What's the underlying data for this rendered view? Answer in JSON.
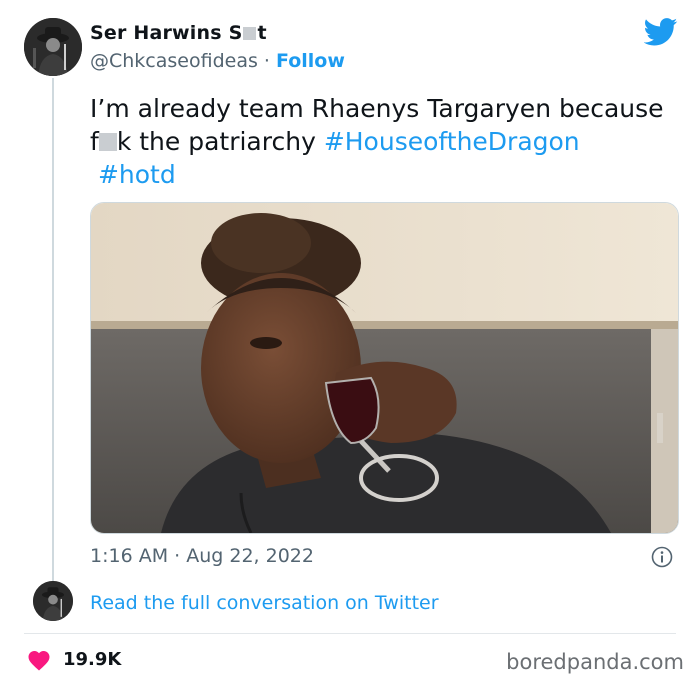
{
  "author": {
    "name_part1": "Ser Harwins S",
    "name_part2": "t",
    "handle": "@Chkcaseofideas",
    "separator": " · ",
    "follow_label": "Follow"
  },
  "tweet": {
    "text_line1": "I’m already team Rhaenys Targaryen because",
    "text_part_f": "f",
    "text_part_after": "k the patriarchy ",
    "hashtag1": "#HouseoftheDragon",
    "hashtag2": "#hotd",
    "time": "1:16 AM",
    "date_separator": " · ",
    "date": "Aug 22, 2022"
  },
  "footer": {
    "read_link": "Read the full conversation on Twitter",
    "likes": "19.9K",
    "watermark": "boredpanda.com"
  },
  "colors": {
    "accent": "#1d9bf0",
    "heart": "#f91880",
    "text": "#0f1419",
    "muted": "#536471"
  },
  "icons": {
    "brand": "twitter-bird-icon",
    "info": "info-icon",
    "like": "heart-icon"
  }
}
